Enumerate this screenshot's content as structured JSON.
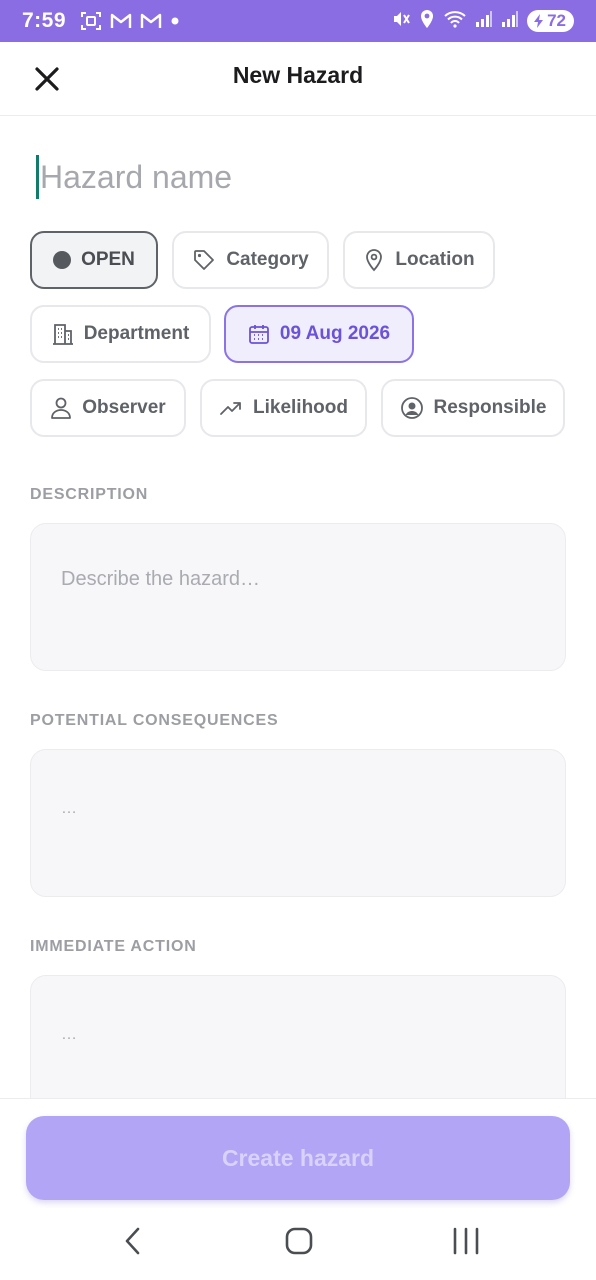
{
  "status_bar": {
    "time": "7:59",
    "battery_level": "72",
    "left_icons": [
      "screenshot-icon",
      "gmail-icon",
      "gmail-icon",
      "notification-dot-icon"
    ],
    "right_icons": [
      "mute-icon",
      "location-icon",
      "wifi-icon",
      "signal-icon",
      "signal-icon",
      "battery-icon"
    ],
    "color": "#8a6de3"
  },
  "header": {
    "title": "New Hazard",
    "close_icon": "close-icon"
  },
  "form": {
    "name_placeholder": "Hazard name",
    "chips": {
      "status": "OPEN",
      "category": "Category",
      "location": "Location",
      "department": "Department",
      "date": "09 Aug 2026",
      "observer": "Observer",
      "likelihood": "Likelihood",
      "responsible": "Responsible"
    },
    "description": {
      "label": "DESCRIPTION",
      "placeholder": "Describe the hazard…"
    },
    "consequences": {
      "label": "POTENTIAL CONSEQUENCES",
      "placeholder": "…"
    },
    "immediate_action": {
      "label": "IMMEDIATE ACTION",
      "placeholder": "…"
    }
  },
  "actions": {
    "create_label": "Create hazard"
  },
  "colors": {
    "accent": "#6c52d6",
    "accent_light": "#f0edfd",
    "button_disabled": "#b3a5f5",
    "caret": "#127c6a"
  },
  "nav": {
    "icons": [
      "back-icon",
      "home-icon",
      "recents-icon"
    ]
  }
}
